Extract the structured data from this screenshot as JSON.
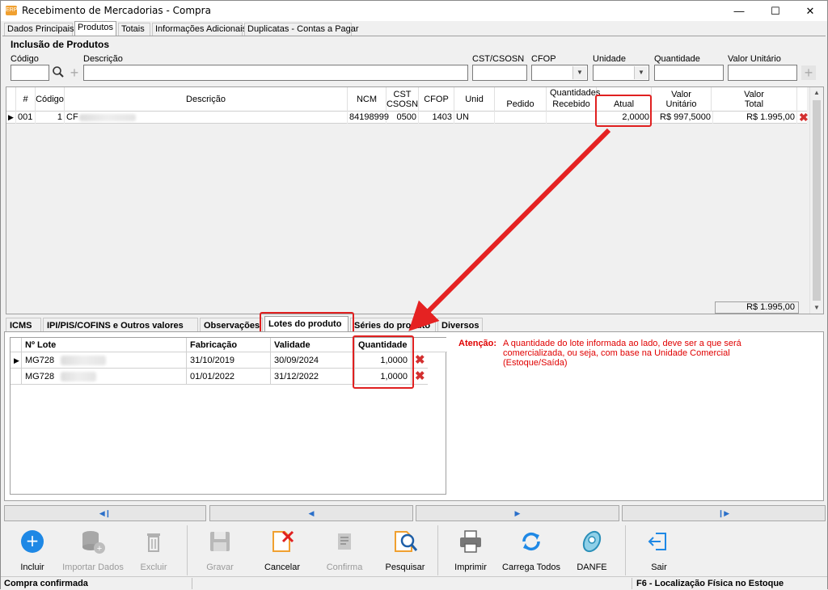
{
  "window": {
    "title": "Recebimento de Mercadorias - Compra",
    "icon_text": "ERP"
  },
  "main_tabs": [
    "Dados Principais",
    "Produtos",
    "Totais",
    "Informações Adicionais",
    "Duplicatas - Contas a Pagar"
  ],
  "inclusao": {
    "section_title": "Inclusão de Produtos",
    "labels": {
      "codigo": "Código",
      "descricao": "Descrição",
      "cst": "CST/CSOSN",
      "cfop": "CFOP",
      "unidade": "Unidade",
      "quantidade": "Quantidade",
      "valor_unitario": "Valor Unitário"
    }
  },
  "grid": {
    "headers": {
      "num": "#",
      "codigo": "Código",
      "descricao": "Descrição",
      "ncm": "NCM",
      "cst": "CST CSOSN",
      "cfop": "CFOP",
      "unid": "Unid",
      "quantidades": "Quantidades",
      "pedido": "Pedido",
      "recebido": "Recebido",
      "atual": "Atual",
      "valor_unitario": "Valor Unitário",
      "valor_total": "Valor Total"
    },
    "row": {
      "num": "001",
      "codigo": "1",
      "descricao": "CF",
      "ncm": "84198999",
      "cst": "0500",
      "cfop": "1403",
      "unid": "UN",
      "pedido": "",
      "recebido": "",
      "atual": "2,0000",
      "valor_unitario": "R$ 997,5000",
      "valor_total": "R$ 1.995,00"
    },
    "total": "R$ 1.995,00"
  },
  "sub_tabs": [
    "ICMS",
    "IPI/PIS/COFINS e Outros valores",
    "Observações",
    "Lotes do produto",
    "Séries do produto",
    "Diversos"
  ],
  "lotes": {
    "headers": {
      "lote": "Nº Lote",
      "fabricacao": "Fabricação",
      "validade": "Validade",
      "quantidade": "Quantidade"
    },
    "rows": [
      {
        "lote": "MG728",
        "fabricacao": "31/10/2019",
        "validade": "30/09/2024",
        "quantidade": "1,0000"
      },
      {
        "lote": "MG728",
        "fabricacao": "01/01/2022",
        "validade": "31/12/2022",
        "quantidade": "1,0000"
      }
    ]
  },
  "atencao": {
    "label": "Atenção:",
    "text": "A quantidade do lote informada ao lado, deve ser a que será comercializada, ou seja, com base na Unidade Comercial (Estoque/Saída)"
  },
  "toolbar": {
    "incluir": "Incluir",
    "importar": "Importar Dados",
    "excluir": "Excluir",
    "gravar": "Gravar",
    "cancelar": "Cancelar",
    "confirma": "Confirma",
    "pesquisar": "Pesquisar",
    "imprimir": "Imprimir",
    "carrega": "Carrega Todos",
    "danfe": "DANFE",
    "sair": "Sair"
  },
  "status": {
    "left": "Compra confirmada",
    "right": "F6 - Localização Física no Estoque"
  },
  "colors": {
    "accent_blue": "#1e88e5",
    "highlight_red": "#e02020",
    "delete_red": "#d32f2f"
  }
}
